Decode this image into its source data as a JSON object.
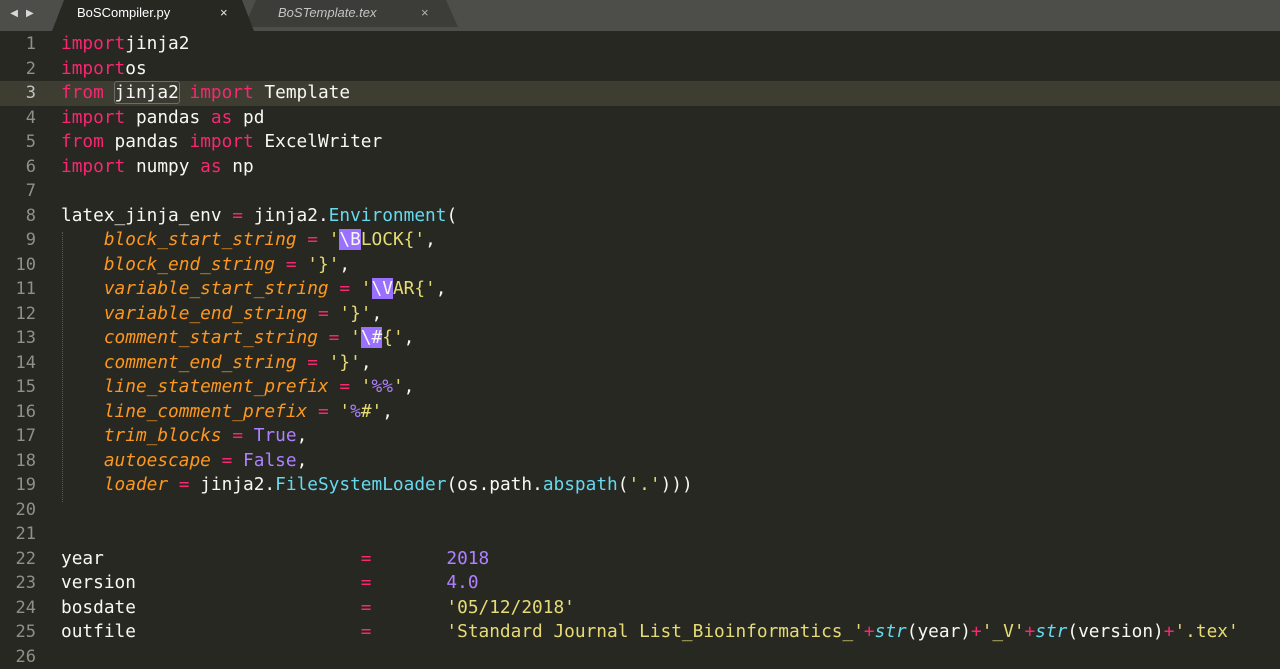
{
  "tabs": [
    {
      "label": "BoSCompiler.py",
      "active": true,
      "close": "×"
    },
    {
      "label": "BoSTemplate.tex",
      "active": false,
      "close": "×"
    }
  ],
  "nav": {
    "back": "◀",
    "forward": "▶"
  },
  "colors": {
    "background": "#272822",
    "keyword": "#f92672",
    "function": "#66d9ef",
    "parameter": "#fd971f",
    "string": "#e6db74",
    "number": "#ae81ff"
  },
  "editor": {
    "current_line": 3,
    "lines": [
      {
        "n": "1",
        "tokens": [
          [
            "kw",
            "import"
          ],
          [
            "",
            "jinja2"
          ]
        ]
      },
      {
        "n": "2",
        "tokens": [
          [
            "kw",
            "import"
          ],
          [
            "",
            "os"
          ]
        ]
      },
      {
        "n": "3",
        "tokens": [
          [
            "kw",
            "from"
          ],
          [
            "",
            " "
          ],
          [
            "wordhl",
            "jinja2"
          ],
          [
            "kw",
            " import"
          ],
          [
            "",
            " Template"
          ]
        ]
      },
      {
        "n": "4",
        "tokens": [
          [
            "kw",
            "import"
          ],
          [
            "",
            " pandas "
          ],
          [
            "kw",
            "as"
          ],
          [
            "",
            " pd"
          ]
        ]
      },
      {
        "n": "5",
        "tokens": [
          [
            "kw",
            "from"
          ],
          [
            "",
            " pandas "
          ],
          [
            "kw",
            "import"
          ],
          [
            "",
            " ExcelWriter"
          ]
        ]
      },
      {
        "n": "6",
        "tokens": [
          [
            "kw",
            "import"
          ],
          [
            "",
            " numpy "
          ],
          [
            "kw",
            "as"
          ],
          [
            "",
            " np"
          ]
        ]
      },
      {
        "n": "7",
        "tokens": []
      },
      {
        "n": "8",
        "tokens": [
          [
            "",
            "latex_jinja_env "
          ],
          [
            "op",
            "="
          ],
          [
            "",
            " jinja2."
          ],
          [
            "fn",
            "Environment"
          ],
          [
            "",
            "("
          ]
        ]
      },
      {
        "n": "9",
        "tokens": [
          [
            "",
            "    "
          ],
          [
            "param",
            "block_start_string"
          ],
          [
            "",
            " "
          ],
          [
            "op",
            "="
          ],
          [
            "",
            " "
          ],
          [
            "str",
            "'"
          ],
          [
            "esc",
            "\\B"
          ],
          [
            "str",
            "LOCK{'"
          ],
          [
            "",
            ","
          ]
        ]
      },
      {
        "n": "10",
        "tokens": [
          [
            "",
            "    "
          ],
          [
            "param",
            "block_end_string"
          ],
          [
            "",
            " "
          ],
          [
            "op",
            "="
          ],
          [
            "",
            " "
          ],
          [
            "str",
            "'}'"
          ],
          [
            "",
            ","
          ]
        ]
      },
      {
        "n": "11",
        "tokens": [
          [
            "",
            "    "
          ],
          [
            "param",
            "variable_start_string"
          ],
          [
            "",
            " "
          ],
          [
            "op",
            "="
          ],
          [
            "",
            " "
          ],
          [
            "str",
            "'"
          ],
          [
            "esc",
            "\\V"
          ],
          [
            "str",
            "AR{'"
          ],
          [
            "",
            ","
          ]
        ]
      },
      {
        "n": "12",
        "tokens": [
          [
            "",
            "    "
          ],
          [
            "param",
            "variable_end_string"
          ],
          [
            "",
            " "
          ],
          [
            "op",
            "="
          ],
          [
            "",
            " "
          ],
          [
            "str",
            "'}'"
          ],
          [
            "",
            ","
          ]
        ]
      },
      {
        "n": "13",
        "tokens": [
          [
            "",
            "    "
          ],
          [
            "param",
            "comment_start_string"
          ],
          [
            "",
            " "
          ],
          [
            "op",
            "="
          ],
          [
            "",
            " "
          ],
          [
            "str",
            "'"
          ],
          [
            "esc",
            "\\#"
          ],
          [
            "str",
            "{'"
          ],
          [
            "",
            ","
          ]
        ]
      },
      {
        "n": "14",
        "tokens": [
          [
            "",
            "    "
          ],
          [
            "param",
            "comment_end_string"
          ],
          [
            "",
            " "
          ],
          [
            "op",
            "="
          ],
          [
            "",
            " "
          ],
          [
            "str",
            "'}'"
          ],
          [
            "",
            ","
          ]
        ]
      },
      {
        "n": "15",
        "tokens": [
          [
            "",
            "    "
          ],
          [
            "param",
            "line_statement_prefix"
          ],
          [
            "",
            " "
          ],
          [
            "op",
            "="
          ],
          [
            "",
            " "
          ],
          [
            "str",
            "'"
          ],
          [
            "num",
            "%%"
          ],
          [
            "str",
            "'"
          ],
          [
            "",
            ","
          ]
        ]
      },
      {
        "n": "16",
        "tokens": [
          [
            "",
            "    "
          ],
          [
            "param",
            "line_comment_prefix"
          ],
          [
            "",
            " "
          ],
          [
            "op",
            "="
          ],
          [
            "",
            " "
          ],
          [
            "str",
            "'"
          ],
          [
            "num",
            "%"
          ],
          [
            "str",
            "#'"
          ],
          [
            "",
            ","
          ]
        ]
      },
      {
        "n": "17",
        "tokens": [
          [
            "",
            "    "
          ],
          [
            "param",
            "trim_blocks"
          ],
          [
            "",
            " "
          ],
          [
            "op",
            "="
          ],
          [
            "",
            " "
          ],
          [
            "num",
            "True"
          ],
          [
            "",
            ","
          ]
        ]
      },
      {
        "n": "18",
        "tokens": [
          [
            "",
            "    "
          ],
          [
            "param",
            "autoescape"
          ],
          [
            "",
            " "
          ],
          [
            "op",
            "="
          ],
          [
            "",
            " "
          ],
          [
            "num",
            "False"
          ],
          [
            "",
            ","
          ]
        ]
      },
      {
        "n": "19",
        "tokens": [
          [
            "",
            "    "
          ],
          [
            "param",
            "loader"
          ],
          [
            "",
            " "
          ],
          [
            "op",
            "="
          ],
          [
            "",
            " jinja2."
          ],
          [
            "fn",
            "FileSystemLoader"
          ],
          [
            "",
            "(os.path."
          ],
          [
            "fn",
            "abspath"
          ],
          [
            "",
            "("
          ],
          [
            "str",
            "'.'"
          ],
          [
            "",
            ")))"
          ]
        ]
      },
      {
        "n": "20",
        "tokens": []
      },
      {
        "n": "21",
        "tokens": []
      },
      {
        "n": "22",
        "tokens": [
          [
            "",
            "year                        "
          ],
          [
            "op",
            "="
          ],
          [
            "",
            "       "
          ],
          [
            "num",
            "2018"
          ]
        ]
      },
      {
        "n": "23",
        "tokens": [
          [
            "",
            "version                     "
          ],
          [
            "op",
            "="
          ],
          [
            "",
            "       "
          ],
          [
            "num",
            "4.0"
          ]
        ]
      },
      {
        "n": "24",
        "tokens": [
          [
            "",
            "bosdate                     "
          ],
          [
            "op",
            "="
          ],
          [
            "",
            "       "
          ],
          [
            "str",
            "'05/12/2018'"
          ]
        ]
      },
      {
        "n": "25",
        "tokens": [
          [
            "",
            "outfile                     "
          ],
          [
            "op",
            "="
          ],
          [
            "",
            "       "
          ],
          [
            "str",
            "'Standard Journal List_Bioinformatics_'"
          ],
          [
            "op",
            "+"
          ],
          [
            "builtin",
            "str"
          ],
          [
            "",
            "(year)"
          ],
          [
            "op",
            "+"
          ],
          [
            "str",
            "'_V'"
          ],
          [
            "op",
            "+"
          ],
          [
            "builtin",
            "str"
          ],
          [
            "",
            "(version)"
          ],
          [
            "op",
            "+"
          ],
          [
            "str",
            "'.tex'"
          ]
        ]
      },
      {
        "n": "26",
        "tokens": []
      }
    ]
  }
}
